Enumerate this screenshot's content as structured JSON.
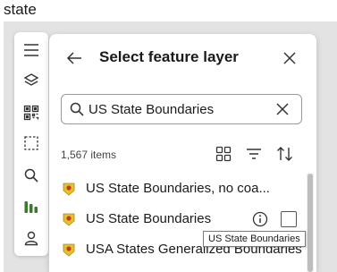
{
  "top_label": "state",
  "toolbar": {
    "items": [
      "menu-icon",
      "layers-icon",
      "qr-code-icon",
      "select-region-icon",
      "search-icon",
      "analysis-icon",
      "profile-icon"
    ],
    "accent": "#3a7a2d"
  },
  "panel": {
    "title": "Select feature layer",
    "search": {
      "value": "US State Boundaries",
      "placeholder": "Search"
    },
    "count_label": "1,567 items",
    "items": [
      {
        "label": "US State Boundaries, no coa..."
      },
      {
        "label": "US State Boundaries"
      },
      {
        "label": "USA States Generalized Boundaries"
      }
    ]
  },
  "tooltip": "US State Boundaries",
  "colors": {
    "layer_icon": "#e6c229",
    "text": "#1a1a1a",
    "background": "#e3e3e3"
  }
}
